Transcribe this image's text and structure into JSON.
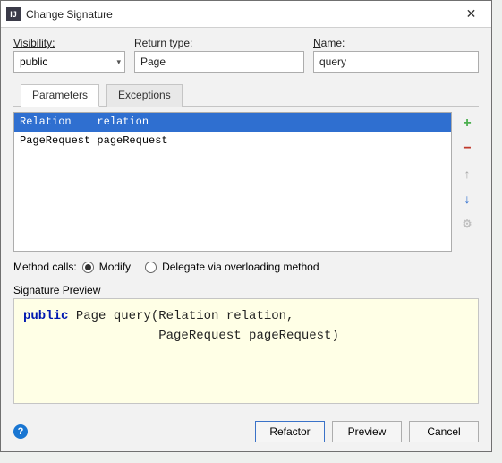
{
  "title": "Change Signature",
  "fields": {
    "visibility_label": "Visibility:",
    "visibility_value": "public",
    "return_label": "Return type:",
    "return_value": "Page",
    "name_label_pre": "",
    "name_label_ul": "N",
    "name_label_post": "ame:",
    "name_value": "query"
  },
  "tabs": {
    "parameters": "Parameters",
    "exceptions": "Exceptions"
  },
  "params": [
    {
      "type": "Relation",
      "name": "relation",
      "selected": true
    },
    {
      "type": "PageRequest",
      "name": "pageRequest",
      "selected": false
    }
  ],
  "method_calls": {
    "label": "Method calls:",
    "modify_ul": "M",
    "modify_post": "odify",
    "delegate": "Delegate via overloading method"
  },
  "signature": {
    "label": "Signature Preview",
    "kw": "public",
    "line1_rest": " Page query(Relation relation,",
    "line2": "                  PageRequest pageRequest)"
  },
  "buttons": {
    "refactor_ul": "R",
    "refactor_post": "efactor",
    "preview_pre": "Pre",
    "preview_ul": "v",
    "preview_post": "iew",
    "cancel": "Cancel"
  }
}
